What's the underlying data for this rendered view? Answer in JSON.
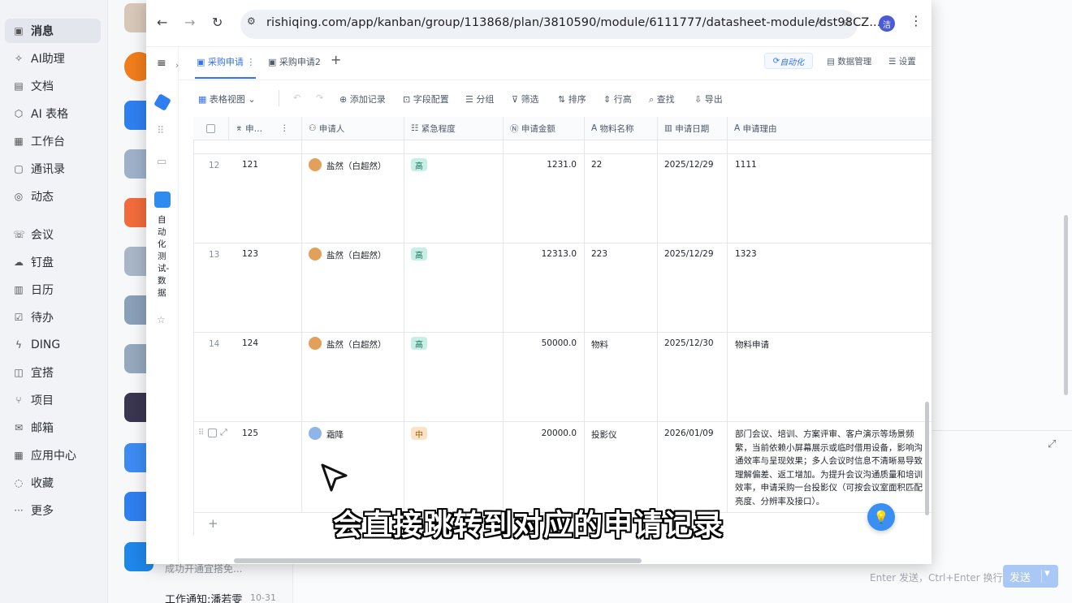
{
  "nav": {
    "items": [
      {
        "label": "消息",
        "icon": "message-icon"
      },
      {
        "label": "AI助理",
        "icon": "ai-assistant-icon"
      },
      {
        "label": "文档",
        "icon": "document-icon"
      },
      {
        "label": "AI 表格",
        "icon": "ai-table-icon"
      },
      {
        "label": "工作台",
        "icon": "workbench-icon"
      },
      {
        "label": "通讯录",
        "icon": "contacts-icon"
      },
      {
        "label": "动态",
        "icon": "feed-icon"
      },
      {
        "label": "会议",
        "icon": "meeting-icon"
      },
      {
        "label": "钉盘",
        "icon": "drive-icon"
      },
      {
        "label": "日历",
        "icon": "calendar-icon"
      },
      {
        "label": "待办",
        "icon": "todo-icon"
      },
      {
        "label": "DING",
        "icon": "ding-icon"
      },
      {
        "label": "宜搭",
        "icon": "yida-icon"
      },
      {
        "label": "项目",
        "icon": "project-icon"
      },
      {
        "label": "邮箱",
        "icon": "mail-icon"
      },
      {
        "label": "应用中心",
        "icon": "app-center-icon"
      },
      {
        "label": "收藏",
        "icon": "favorites-icon"
      },
      {
        "label": "更多",
        "icon": "more-icon"
      }
    ]
  },
  "chatlist": {
    "tail1": "成功开通宜搭免...",
    "tail2": "工作通知:潘若雯",
    "tail2_time": "10-31"
  },
  "chat": {
    "send_hint": "Enter 发送，Ctrl+Enter 换行",
    "send_label": "发送"
  },
  "browser": {
    "url": "rishiqing.com/app/kanban/group/113868/plan/3810590/module/6111777/datasheet-module/dst98CZ...",
    "profile_initial": "洁"
  },
  "app": {
    "rail_label": "自动化测试-数据",
    "tabs": [
      "采购申请",
      "采购申请2"
    ],
    "automation": "自动化",
    "data_manage": "数据管理",
    "settings": "设置",
    "toolbar": {
      "view": "表格视图",
      "add_record": "添加记录",
      "field_config": "字段配置",
      "group": "分组",
      "filter": "筛选",
      "sort": "排序",
      "row_height": "行高",
      "search": "查找",
      "export": "导出"
    },
    "columns": [
      "申…",
      "申请人",
      "紧急程度",
      "申请金额",
      "物料名称",
      "申请日期",
      "申请理由"
    ],
    "rows": [
      {
        "num": "12",
        "id": "121",
        "applicant": "盐然（白超然）",
        "urgency": "高",
        "amount": "1231.0",
        "material": "22",
        "date": "2025/12/29",
        "reason": "1111"
      },
      {
        "num": "13",
        "id": "123",
        "applicant": "盐然（白超然）",
        "urgency": "高",
        "amount": "12313.0",
        "material": "223",
        "date": "2025/12/29",
        "reason": "1323"
      },
      {
        "num": "14",
        "id": "124",
        "applicant": "盐然（白超然）",
        "urgency": "高",
        "amount": "50000.0",
        "material": "物料",
        "date": "2025/12/30",
        "reason": "物料申请"
      },
      {
        "num": "",
        "id": "125",
        "applicant": "霜降",
        "urgency": "中",
        "amount": "20000.0",
        "material": "投影仪",
        "date": "2026/01/09",
        "reason": "部门会议、培训、方案评审、客户演示等场景频繁，当前依赖小屏幕展示或临时借用设备，影响沟通效率与呈现效果；多人会议时信息不清晰易导致理解偏差、返工增加。为提升会议沟通质量和培训效率，申请采购一台投影仪（可按会议室面积匹配亮度、分辨率及接口）。"
      }
    ],
    "colors": {
      "accent": "#3370ff",
      "high": "#c6efe6",
      "mid": "#fde3c6"
    }
  },
  "subtitle": "会直接跳转到对应的申请记录"
}
